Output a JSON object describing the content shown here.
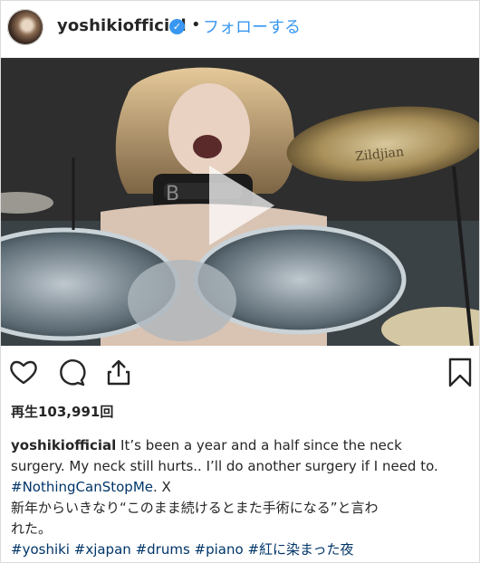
{
  "header": {
    "username": "yoshikiofficial",
    "verified_icon": "verified-check",
    "separator": "•",
    "follow_label": "フォローする"
  },
  "media": {
    "type": "video",
    "play_icon": "play-triangle"
  },
  "actions": {
    "like_icon": "heart-outline",
    "comment_icon": "speech-bubble",
    "share_icon": "share-upload",
    "save_icon": "bookmark-outline"
  },
  "stats": {
    "views": "再生103,991回"
  },
  "caption": {
    "username": "yoshikiofficial",
    "text_line1": " It’s been a year and a half since the neck",
    "text_line2": "surgery. My neck still hurts.. I’ll do another surgery if I need to.",
    "hashtag_nothing": "#NothingCanStopMe",
    "text_after_tag": ". X",
    "jp_line1": "新年からいきなり“このまま続けるとまた手術になる”と言わ",
    "jp_line2": "れた。",
    "tags": [
      "#yoshiki",
      "#xjapan",
      "#drums",
      "#piano",
      "#紅に染まった夜"
    ]
  },
  "colors": {
    "link_blue": "#3897f0",
    "hashtag_navy": "#003569",
    "text": "#262626",
    "border": "#dbdbdb"
  }
}
